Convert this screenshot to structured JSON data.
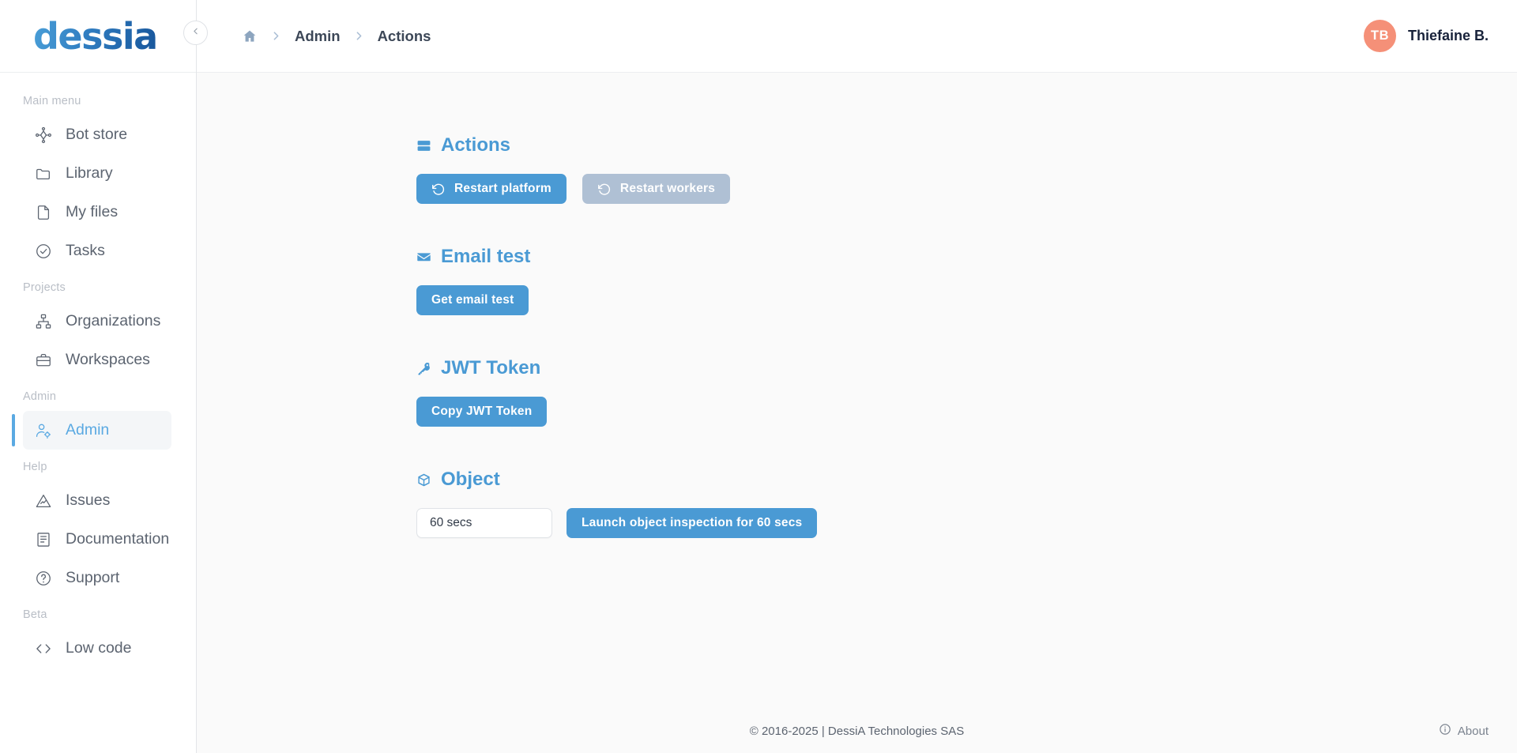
{
  "brand": {
    "logo_text": "dessia",
    "accent": "#4a9ad4",
    "avatar_color": "#f59078"
  },
  "sidebar": {
    "groups": [
      {
        "label": "Main menu",
        "items": [
          {
            "label": "Bot store",
            "icon": "bot-store-icon",
            "active": false
          },
          {
            "label": "Library",
            "icon": "folder-icon",
            "active": false
          },
          {
            "label": "My files",
            "icon": "file-icon",
            "active": false
          },
          {
            "label": "Tasks",
            "icon": "check-circle-icon",
            "active": false
          }
        ]
      },
      {
        "label": "Projects",
        "items": [
          {
            "label": "Organizations",
            "icon": "org-chart-icon",
            "active": false
          },
          {
            "label": "Workspaces",
            "icon": "briefcase-icon",
            "active": false
          }
        ]
      },
      {
        "label": "Admin",
        "items": [
          {
            "label": "Admin",
            "icon": "user-cog-icon",
            "active": true
          }
        ]
      },
      {
        "label": "Help",
        "items": [
          {
            "label": "Issues",
            "icon": "alert-triangle-icon",
            "active": false
          },
          {
            "label": "Documentation",
            "icon": "book-icon",
            "active": false
          },
          {
            "label": "Support",
            "icon": "question-circle-icon",
            "active": false
          }
        ]
      },
      {
        "label": "Beta",
        "items": [
          {
            "label": "Low code",
            "icon": "code-brackets-icon",
            "active": false
          }
        ]
      }
    ]
  },
  "topbar": {
    "breadcrumb": [
      {
        "label": "Admin"
      },
      {
        "label": "Actions"
      }
    ],
    "home_icon": "home-icon",
    "collapse_icon": "chevron-left-icon",
    "user": {
      "initials": "TB",
      "name": "Thiefaine B."
    }
  },
  "main": {
    "sections": [
      {
        "id": "actions",
        "title": "Actions",
        "icon": "server-icon",
        "buttons": [
          {
            "label": "Restart platform",
            "icon": "rotate-ccw-icon",
            "style": "primary"
          },
          {
            "label": "Restart workers",
            "icon": "rotate-ccw-icon",
            "style": "muted"
          }
        ]
      },
      {
        "id": "email-test",
        "title": "Email test",
        "icon": "envelope-icon",
        "buttons": [
          {
            "label": "Get email test",
            "icon": null,
            "style": "primary"
          }
        ]
      },
      {
        "id": "jwt-token",
        "title": "JWT Token",
        "icon": "key-icon",
        "buttons": [
          {
            "label": "Copy JWT Token",
            "icon": null,
            "style": "primary"
          }
        ]
      }
    ],
    "object_section": {
      "title": "Object",
      "icon": "cube-icon",
      "duration_value": "60 secs",
      "duration_placeholder": "60 secs",
      "launch_label": "Launch object inspection for 60 secs"
    }
  },
  "footer": {
    "copyright": "© 2016-2025 | DessiA Technologies SAS",
    "about_label": "About",
    "about_icon": "info-circle-icon"
  }
}
